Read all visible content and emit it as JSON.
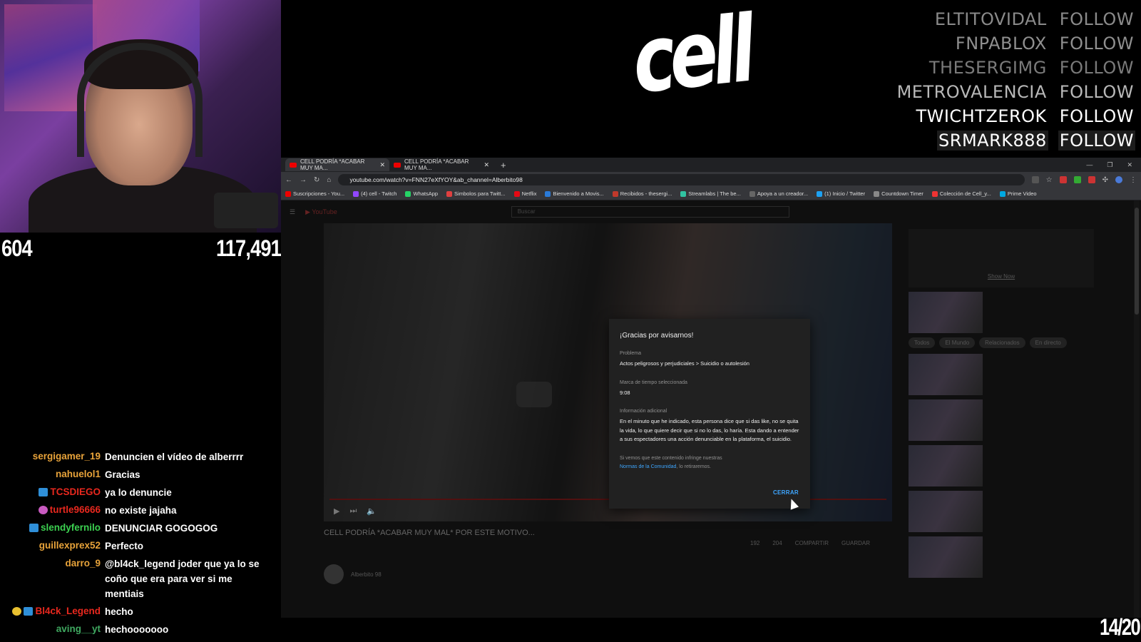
{
  "stats": {
    "left": "604",
    "right": "117,491"
  },
  "logo": "cell",
  "follows": [
    {
      "name": "ELTITOVIDAL",
      "word": "FOLLOW",
      "color": "#8a8a8a",
      "bg": "transparent"
    },
    {
      "name": "FNPABLOX",
      "word": "FOLLOW",
      "color": "#8f8f8f",
      "bg": "transparent"
    },
    {
      "name": "THESERGIMG",
      "word": "FOLLOW",
      "color": "#7a7a7a",
      "bg": "transparent"
    },
    {
      "name": "METROVALENCIA",
      "word": "FOLLOW",
      "color": "#b8b8b8",
      "bg": "transparent"
    },
    {
      "name": "TWICHTZEROK",
      "word": "FOLLOW",
      "color": "#ffffff",
      "bg": "transparent"
    },
    {
      "name": "SRMARK888",
      "word": "FOLLOW",
      "color": "#ffffff",
      "bg": "#1c1c1c"
    }
  ],
  "chat": [
    {
      "user": "sergigamer_19",
      "color": "#e8a33a",
      "msg": "Denuncien el vídeo de alberrrr",
      "badges": []
    },
    {
      "user": "nahuelol1",
      "color": "#e8a33a",
      "msg": "Gracias",
      "badges": []
    },
    {
      "user": "TCSDIEGO",
      "color": "#e8281e",
      "msg": "ya lo denuncie",
      "badges": [
        "#2f8fd8"
      ]
    },
    {
      "user": "turtle96666",
      "color": "#e8281e",
      "msg": "no existe jajaha",
      "badges": [
        "#c85ac0"
      ]
    },
    {
      "user": "slendyfernilo",
      "color": "#3cd050",
      "msg": "DENUNCIAR GOGOGOG",
      "badges": [
        "#2f8fd8"
      ]
    },
    {
      "user": "guillexprex52",
      "color": "#e8a33a",
      "msg": "Perfecto",
      "badges": []
    },
    {
      "user": "darro_9",
      "color": "#e8a33a",
      "msg": "@bl4ck_legend joder que ya lo se coño que era para ver si me mentiais",
      "badges": []
    },
    {
      "user": "Bl4ck_Legend",
      "color": "#e8281e",
      "msg": "hecho",
      "badges": [
        "#e8c030",
        "#2f8fd8"
      ]
    },
    {
      "user": "aving__yt",
      "color": "#3fa860",
      "msg": "hechooooooo",
      "badges": []
    }
  ],
  "browser": {
    "tabs": [
      {
        "label": "CELL PODRÍA *ACABAR MUY MA...",
        "active": true
      },
      {
        "label": "CELL PODRÍA *ACABAR MUY MA...",
        "active": false
      }
    ],
    "url": "youtube.com/watch?v=FNN27eXfYOY&ab_channel=Alberbito98",
    "bookmarks": [
      {
        "label": "Suscripciones - You...",
        "color": "#e00"
      },
      {
        "label": "(4) cell - Twitch",
        "color": "#9147ff"
      },
      {
        "label": "WhatsApp",
        "color": "#25d366"
      },
      {
        "label": "Simbolos para Twitt...",
        "color": "#e04040"
      },
      {
        "label": "Netflix",
        "color": "#e50914"
      },
      {
        "label": "Bienvenido a Movis...",
        "color": "#2a7ad8"
      },
      {
        "label": "Recibidos - thesergi...",
        "color": "#c0392b"
      },
      {
        "label": "Streamlabs | The be...",
        "color": "#31c3a2"
      },
      {
        "label": "Apoya a un creador...",
        "color": "#666"
      },
      {
        "label": "(1) Inicio / Twitter",
        "color": "#1da1f2"
      },
      {
        "label": "Countdown Timer",
        "color": "#888"
      },
      {
        "label": "Colección de Cell_y...",
        "color": "#e33"
      },
      {
        "label": "Prime Video",
        "color": "#00a8e1"
      }
    ]
  },
  "youtube": {
    "search_placeholder": "Buscar",
    "video_title": "CELL PODRÍA *ACABAR MUY MAL* POR ESTE MOTIVO...",
    "chips": [
      "Todos",
      "El Mundo",
      "Relacionados",
      "En directo"
    ],
    "actions": [
      "192",
      "204",
      "COMPARTIR",
      "GUARDAR"
    ],
    "channel": "Alberbito 98",
    "sidebar_link": "Show Now"
  },
  "dialog": {
    "title": "¡Gracias por avisarnos!",
    "problem_label": "Problema",
    "problem_value": "Actos peligrosos y perjudiciales > Suicidio o autolesión",
    "timestamp_label": "Marca de tiempo seleccionada",
    "timestamp_value": "9:08",
    "info_label": "Información adicional",
    "info_value": "En el minuto que he indicado, esta persona dice que si das like, no se quita la vida, lo que quiere decir que si no lo das, lo haría. Esta dando a entender a sus espectadores una acción denunciable en la plataforma, el suicidio.",
    "note_text": "Si vemos que este contenido infringe nuestras",
    "note_link": "Normas de la Comunidad",
    "note_suffix": ", lo retiraremos.",
    "close_label": "CERRAR"
  },
  "page_counter": "14/20"
}
